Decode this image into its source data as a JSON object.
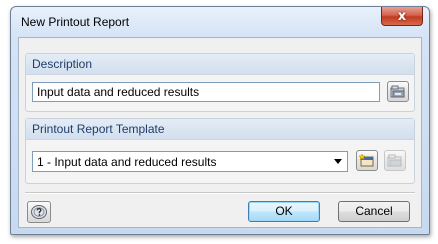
{
  "window": {
    "title": "New Printout Report",
    "close_glyph": "x"
  },
  "description": {
    "header": "Description",
    "value": "Input data and reduced results",
    "browse_icon": "folder-open-icon"
  },
  "template": {
    "header": "Printout Report Template",
    "selected": "1 - Input data and reduced results",
    "new_icon": "new-template-icon",
    "edit_icon": "edit-template-icon",
    "edit_enabled": false
  },
  "footer": {
    "help_icon": "help-icon",
    "ok_label": "OK",
    "cancel_label": "Cancel"
  },
  "colors": {
    "title_gradient_top": "#e9f1fb",
    "close_red": "#c13a22",
    "group_header_text": "#1f3d6b",
    "default_button_border": "#3c7fb1"
  }
}
